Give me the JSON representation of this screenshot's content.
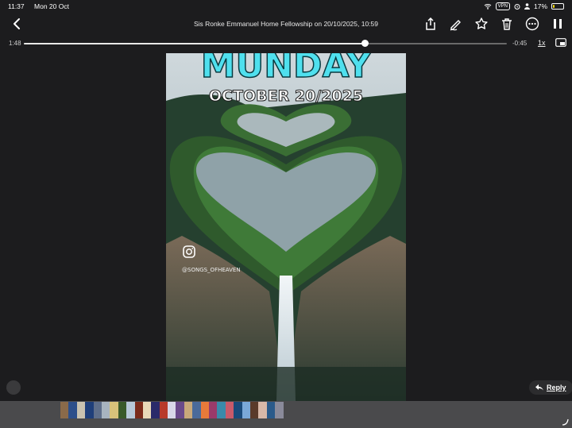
{
  "status": {
    "time": "11:37",
    "date": "Mon 20 Oct",
    "vpn": "VPN",
    "battery": "17%",
    "battery_level": 0.17
  },
  "header": {
    "title": "Sis Ronke Emmanuel Home Fellowship on 20/10/2025, 10:59"
  },
  "player": {
    "elapsed": "1:48",
    "remaining": "-0:45",
    "progress": 0.706,
    "speed": "1x"
  },
  "video": {
    "headline": "MUNDAY",
    "date_text": "OCTOBER 20/2025",
    "watermark": "@SONGS_OFHEAVEN"
  },
  "footer": {
    "reply_label": "Reply"
  },
  "thumbnail_colors": [
    "#8a6a4a",
    "#2d4f8a",
    "#c9c2b0",
    "#1f3f7a",
    "#5e6e8a",
    "#a8b4c0",
    "#d8c27a",
    "#3a5a2a",
    "#b8c8d8",
    "#7a2a1a",
    "#e8d8b8",
    "#2a2a6a",
    "#b83a2a",
    "#d8d8e8",
    "#6a4a8a",
    "#c8a87a",
    "#4a6a9a",
    "#e87a3a",
    "#9a3a6a",
    "#3a8aaa",
    "#c85a6a",
    "#1a4a7a",
    "#7aa8d8",
    "#5a3a2a",
    "#d8b8a8",
    "#2a5a8a",
    "#8a8a9a"
  ],
  "colors": {
    "headline": "#4fe0ee",
    "accent_battery": "#f5d90a"
  }
}
